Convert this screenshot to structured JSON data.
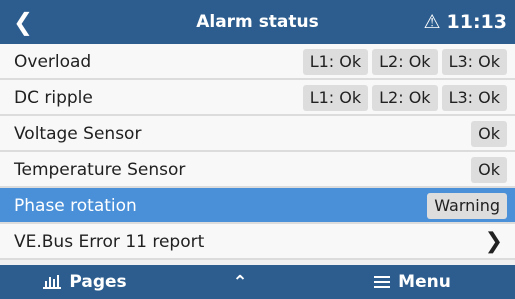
{
  "header": {
    "back_icon": "chevron-left-icon",
    "title": "Alarm status",
    "alert_icon": "warning-triangle-icon",
    "time": "11:13"
  },
  "rows": [
    {
      "label": "Overload",
      "pills": [
        "L1: Ok",
        "L2: Ok",
        "L3: Ok"
      ]
    },
    {
      "label": "DC ripple",
      "pills": [
        "L1: Ok",
        "L2: Ok",
        "L3: Ok"
      ]
    },
    {
      "label": "Voltage Sensor",
      "pills": [
        "Ok"
      ]
    },
    {
      "label": "Temperature Sensor",
      "pills": [
        "Ok"
      ]
    },
    {
      "label": "Phase rotation",
      "pills": [
        "Warning"
      ],
      "selected": true
    },
    {
      "label": "VE.Bus Error 11 report",
      "arrow": "chevron-right-icon"
    }
  ],
  "footer": {
    "pages_label": "Pages",
    "pages_icon": "bar-chart-icon",
    "up_icon": "chevron-up-icon",
    "menu_label": "Menu",
    "menu_icon": "hamburger-icon"
  },
  "colors": {
    "header_bg": "#2c5d8e",
    "selected_bg": "#4a90d9",
    "pill_bg": "#dddddd"
  }
}
